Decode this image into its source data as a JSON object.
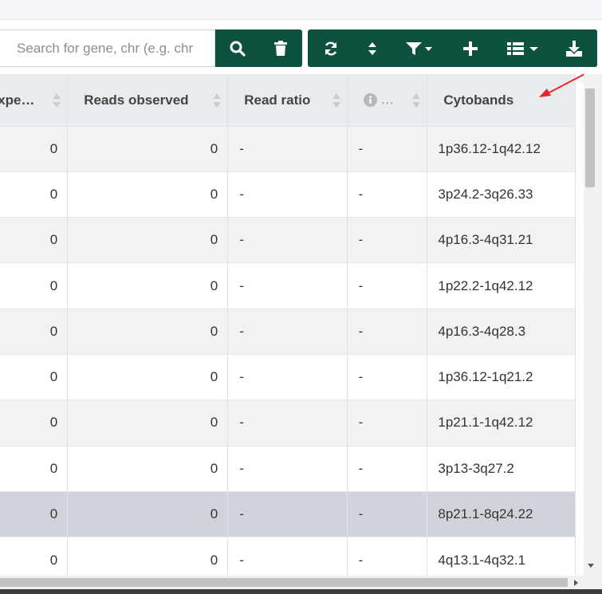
{
  "toolbar": {
    "search_placeholder": "Search for gene, chr (e.g. chr",
    "search_icon": "search-icon",
    "clear_icon": "trash-icon",
    "refresh_icon": "refresh-icon",
    "sort_icon": "sort-icon",
    "filter_icon": "filter-icon",
    "add_icon": "plus-icon",
    "columns_icon": "columns-icon",
    "download_icon": "download-icon",
    "accent_color": "#0d5240"
  },
  "table": {
    "columns": [
      {
        "label": "Reads expected"
      },
      {
        "label": "Reads observed"
      },
      {
        "label": "Read ratio"
      },
      {
        "label": "",
        "icon": "info-icon"
      },
      {
        "label": "Cytobands"
      }
    ],
    "rows": [
      {
        "expected": "0",
        "observed": "0",
        "ratio": "-",
        "info": "-",
        "cytobands": "1p36.12-1q42.12"
      },
      {
        "expected": "0",
        "observed": "0",
        "ratio": "-",
        "info": "-",
        "cytobands": "3p24.2-3q26.33"
      },
      {
        "expected": "0",
        "observed": "0",
        "ratio": "-",
        "info": "-",
        "cytobands": "4p16.3-4q31.21"
      },
      {
        "expected": "0",
        "observed": "0",
        "ratio": "-",
        "info": "-",
        "cytobands": "1p22.2-1q42.12"
      },
      {
        "expected": "0",
        "observed": "0",
        "ratio": "-",
        "info": "-",
        "cytobands": "4p16.3-4q28.3"
      },
      {
        "expected": "0",
        "observed": "0",
        "ratio": "-",
        "info": "-",
        "cytobands": "1p36.12-1q21.2"
      },
      {
        "expected": "0",
        "observed": "0",
        "ratio": "-",
        "info": "-",
        "cytobands": "1p21.1-1q42.12"
      },
      {
        "expected": "0",
        "observed": "0",
        "ratio": "-",
        "info": "-",
        "cytobands": "3p13-3q27.2"
      },
      {
        "expected": "0",
        "observed": "0",
        "ratio": "-",
        "info": "-",
        "cytobands": "8p21.1-8q24.22"
      },
      {
        "expected": "0",
        "observed": "0",
        "ratio": "-",
        "info": "-",
        "cytobands": "4q13.1-4q32.1"
      }
    ],
    "selected_row": 8
  },
  "annotation": {
    "arrow_color": "#e8262a"
  }
}
